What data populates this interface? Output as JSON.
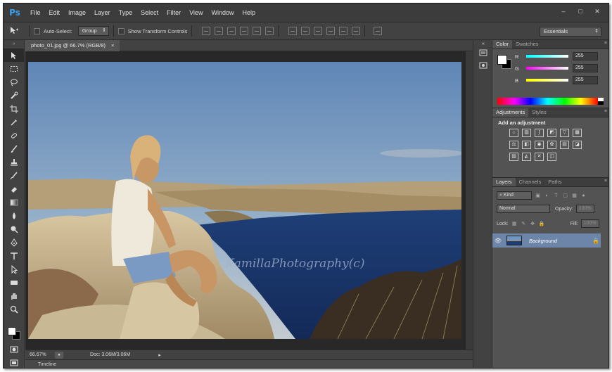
{
  "app": {
    "logo": "Ps"
  },
  "menu": [
    "File",
    "Edit",
    "Image",
    "Layer",
    "Type",
    "Select",
    "Filter",
    "View",
    "Window",
    "Help"
  ],
  "window_controls": [
    "–",
    "□",
    "✕"
  ],
  "options": {
    "tool_icon": "move-tool-icon",
    "auto_select_label": "Auto-Select:",
    "auto_select_checked": false,
    "auto_select_value": "Group",
    "show_transform_label": "Show Transform Controls",
    "show_transform_checked": false,
    "workspace_value": "Essentials"
  },
  "tools": [
    "move",
    "marquee",
    "lasso",
    "quick-select",
    "crop",
    "eyedropper",
    "spot-heal",
    "brush",
    "clone-stamp",
    "history-brush",
    "eraser",
    "gradient",
    "blur",
    "dodge",
    "pen",
    "type",
    "path-select",
    "shape",
    "hand",
    "zoom"
  ],
  "document": {
    "tab_title": "photo_01.jpg @ 66.7% (RGB/8)",
    "tab_close": "×",
    "watermark": "KamillaPhotography(c)"
  },
  "status": {
    "zoom": "66.67%",
    "doc_info": "Doc: 3.06M/3.06M"
  },
  "timeline_label": "Timeline",
  "color_panel": {
    "tabs": [
      "Color",
      "Swatches"
    ],
    "active_tab": "Color",
    "foreground": "#ffffff",
    "background": "#000000",
    "channels": [
      {
        "label": "R",
        "value": "255",
        "color": "#00e5ff"
      },
      {
        "label": "G",
        "value": "255",
        "color": "#ff3df0"
      },
      {
        "label": "B",
        "value": "255",
        "color": "#fff200"
      }
    ]
  },
  "adjustments_panel": {
    "tabs": [
      "Adjustments",
      "Styles"
    ],
    "active_tab": "Adjustments",
    "title": "Add an adjustment"
  },
  "layers_panel": {
    "tabs": [
      "Layers",
      "Channels",
      "Paths"
    ],
    "active_tab": "Layers",
    "filter_kind": "Kind",
    "blend_mode": "Normal",
    "opacity_label": "Opacity:",
    "opacity_value": "100%",
    "lock_label": "Lock:",
    "fill_label": "Fill:",
    "fill_value": "100%",
    "layers": [
      {
        "name": "Background",
        "visible": true,
        "locked": true
      }
    ]
  }
}
